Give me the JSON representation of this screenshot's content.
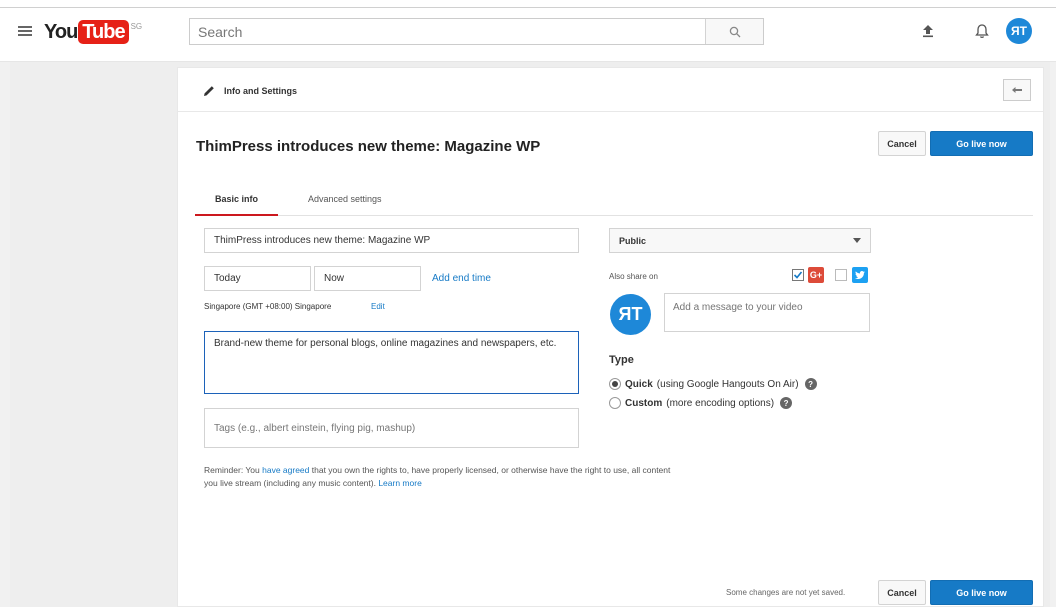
{
  "header": {
    "logo_you": "You",
    "logo_tube": "Tube",
    "country": "SG",
    "search_placeholder": "Search",
    "avatar_initials": "ЯT"
  },
  "panel": {
    "info_label": "Info and Settings",
    "title": "ThimPress introduces new theme: Magazine WP",
    "cancel_label": "Cancel",
    "go_live_label": "Go live now"
  },
  "tabs": [
    {
      "label": "Basic info",
      "active": true
    },
    {
      "label": "Advanced settings",
      "active": false
    }
  ],
  "form": {
    "title_value": "ThimPress introduces new theme: Magazine WP",
    "date_value": "Today",
    "time_value": "Now",
    "add_end_time": "Add end time",
    "timezone": "Singapore (GMT +08:00) Singapore",
    "edit_label": "Edit",
    "description_value": "Brand-new theme for personal blogs, online magazines and newspapers, etc.",
    "tags_placeholder": "Tags (e.g., albert einstein, flying pig, mashup)"
  },
  "privacy": {
    "selected": "Public"
  },
  "share": {
    "label": "Also share on",
    "message_placeholder": "Add a message to your video",
    "gplus_checked": true,
    "twitter_checked": false
  },
  "type": {
    "label": "Type",
    "options": [
      {
        "name": "Quick",
        "desc": "(using Google Hangouts On Air)",
        "selected": true
      },
      {
        "name": "Custom",
        "desc": "(more encoding options)",
        "selected": false
      }
    ]
  },
  "reminder": {
    "prefix": "Reminder: You ",
    "link1": "have agreed",
    "middle": " that you own the rights to, have properly licensed, or otherwise have the right to use, all content you live stream (including any music content). ",
    "link2": "Learn more"
  },
  "footer": {
    "unsaved": "Some changes are not yet saved.",
    "cancel_label": "Cancel",
    "go_live_label": "Go live now"
  },
  "colors": {
    "brand_red": "#e62117",
    "accent_blue": "#167ac6",
    "tab_underline": "#cc181e",
    "gplus": "#dd4b39",
    "twitter": "#1da1f2"
  }
}
